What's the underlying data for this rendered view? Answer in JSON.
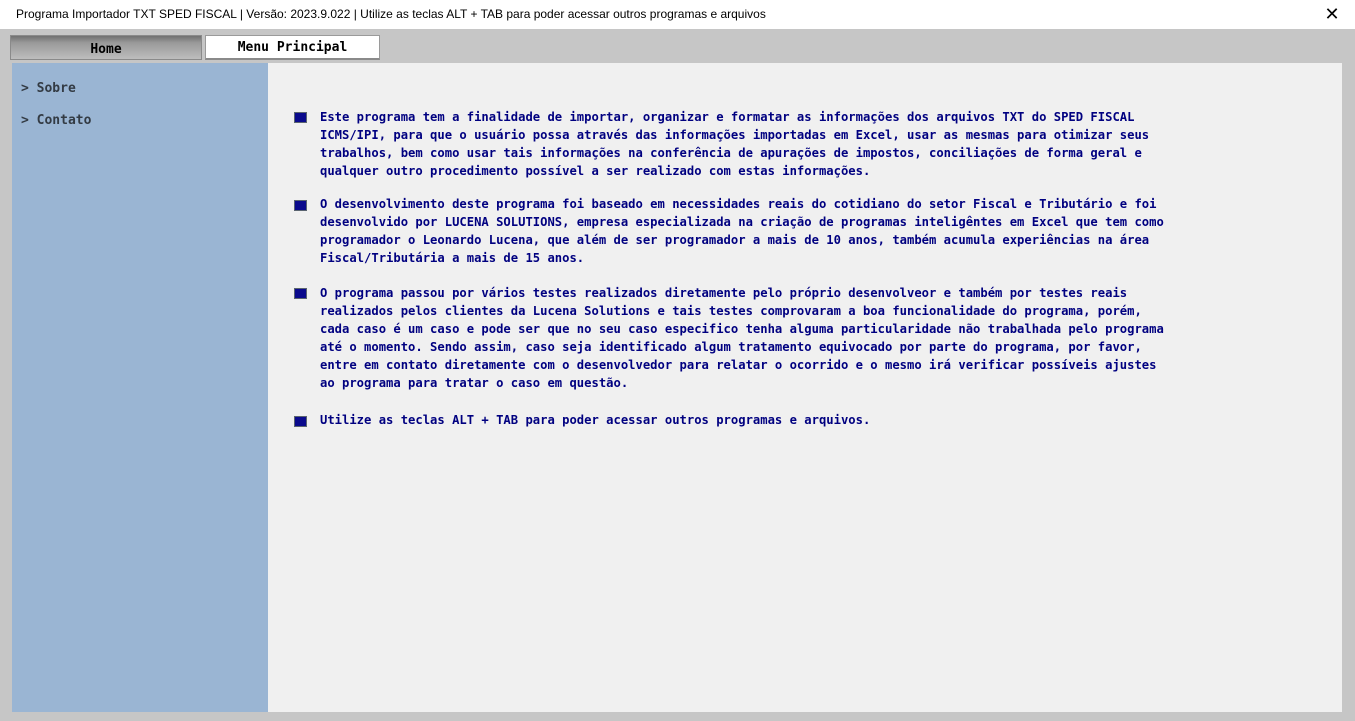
{
  "window": {
    "title": "Programa Importador TXT SPED FISCAL   |   Versão: 2023.9.022   |   Utilize as teclas ALT + TAB para poder acessar outros programas e arquivos",
    "close_glyph": "✕"
  },
  "tabs": {
    "home": "Home",
    "menu": "Menu Principal"
  },
  "sidebar": {
    "items": [
      {
        "label": "> Sobre"
      },
      {
        "label": "> Contato"
      }
    ]
  },
  "content": {
    "paragraphs": [
      {
        "text": "Este programa tem a finalidade de importar, organizar e formatar as informações dos arquivos TXT do SPED FISCAL\nICMS/IPI, para que o usuário possa através das informações importadas em Excel, usar as mesmas para otimizar seus\ntrabalhos, bem como usar tais informações na conferência de apurações de impostos, conciliações de forma geral e\nqualquer outro procedimento possível a ser realizado com estas informações."
      },
      {
        "text": "O desenvolvimento deste programa foi baseado em necessidades reais do cotidiano do setor Fiscal e Tributário e foi\ndesenvolvido por LUCENA SOLUTIONS, empresa especializada na criação de programas inteligêntes em Excel que tem como\nprogramador o Leonardo Lucena, que além de ser programador a mais de 10 anos, também acumula experiências na área\nFiscal/Tributária a mais de 15 anos."
      },
      {
        "text": "O programa passou por vários testes realizados diretamente pelo próprio desenvolveor e também por testes reais\nrealizados pelos clientes da Lucena Solutions e tais testes comprovaram a boa funcionalidade do programa, porém,\ncada caso é um caso e pode ser que no seu caso especifico tenha alguma particularidade não trabalhada pelo programa\naté o momento. Sendo assim, caso seja identificado algum tratamento equivocado por parte do programa, por favor,\nentre em contato diretamente com o desenvolvedor para relatar o ocorrido e o mesmo irá verificar possíveis ajustes\nao programa para tratar o caso em questão."
      },
      {
        "text": "Utilize as teclas ALT + TAB para poder acessar outros programas e arquivos."
      }
    ]
  },
  "colors": {
    "sidebar_bg": "#9ab5d3",
    "content_bg": "#f0f0f0",
    "text_navy": "#000080",
    "bullet": "#0a0a8c"
  }
}
